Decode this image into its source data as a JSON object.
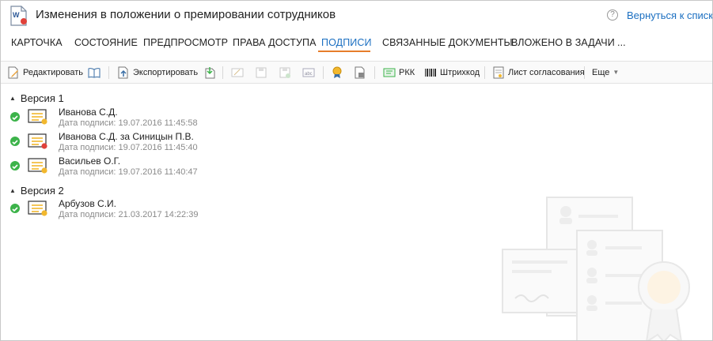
{
  "header": {
    "title": "Изменения в положении о премировании сотрудников",
    "help": "?",
    "back_link": "Вернуться к списку"
  },
  "tabs": [
    {
      "label": "КАРТОЧКА",
      "active": false
    },
    {
      "label": "СОСТОЯНИЕ",
      "active": false
    },
    {
      "label": "ПРЕДПРОСМОТР",
      "active": false
    },
    {
      "label": "ПРАВА ДОСТУПА",
      "active": false
    },
    {
      "label": "ПОДПИСИ",
      "active": true
    },
    {
      "label": "СВЯЗАННЫЕ ДОКУМЕНТЫ",
      "active": false
    },
    {
      "label": "ВЛОЖЕНО В ЗАДАЧИ",
      "active": false
    },
    {
      "label": "...",
      "active": false
    }
  ],
  "toolbar": {
    "edit_label": "Редактировать",
    "export_label": "Экспортировать",
    "rkk_label": "РКК",
    "barcode_label": "Штрихкод",
    "approval_sheet_label": "Лист согласования",
    "more_label": "Еще"
  },
  "versions": [
    {
      "label": "Версия 1",
      "signatures": [
        {
          "name": "Иванова С.Д.",
          "date": "Дата подписи: 19.07.2016 11:45:58",
          "seal_color": "#f2b82e"
        },
        {
          "name": "Иванова С.Д. за Синицын П.В.",
          "date": "Дата подписи: 19.07.2016 11:45:40",
          "seal_color": "#e0413a"
        },
        {
          "name": "Васильев О.Г.",
          "date": "Дата подписи: 19.07.2016 11:40:47",
          "seal_color": "#f2b82e"
        }
      ]
    },
    {
      "label": "Версия 2",
      "signatures": [
        {
          "name": "Арбузов С.И.",
          "date": "Дата подписи: 21.03.2017 14:22:39",
          "seal_color": "#f2b82e"
        }
      ]
    }
  ],
  "colors": {
    "accent": "#1b6fc1",
    "active_tab_underline": "#e77d2b",
    "signed_ok": "#3cb34a"
  },
  "icons": {
    "document": "word-document-icon",
    "help": "help-icon",
    "signed": "check-circle-icon",
    "certificate": "certificate-icon"
  }
}
